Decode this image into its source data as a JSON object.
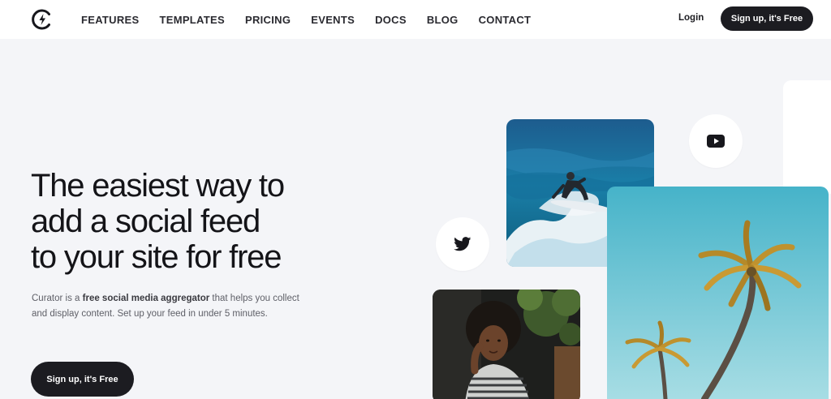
{
  "header": {
    "logo_icon": "lightning-circle-icon",
    "nav": [
      "FEATURES",
      "TEMPLATES",
      "PRICING",
      "EVENTS",
      "DOCS",
      "BLOG",
      "CONTACT"
    ],
    "login_label": "Login",
    "signup_label": "Sign up, it's Free"
  },
  "hero": {
    "title_lines": [
      "The easiest way to",
      "add a social feed",
      "to your site for free"
    ],
    "desc_prefix": "Curator is a ",
    "desc_bold": "free social media aggregator",
    "desc_suffix": " that helps you collect and display content. Set up your feed in under 5 minutes.",
    "cta_label": "Sign up, it's Free"
  },
  "visuals": {
    "youtube_icon": "youtube-icon",
    "twitter_icon": "twitter-icon",
    "photos": [
      "surfer-photo",
      "person-photo",
      "palm-trees-photo"
    ]
  },
  "colors": {
    "background": "#f4f5f8",
    "header_bg": "#ffffff",
    "button_bg": "#1c1c21",
    "text": "#141418"
  }
}
